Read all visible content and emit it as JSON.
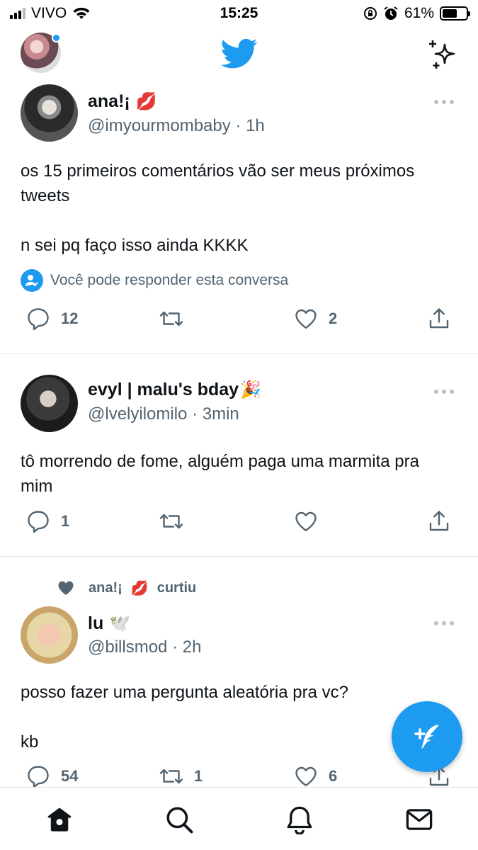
{
  "status_bar": {
    "carrier": "VIVO",
    "time": "15:25",
    "battery": "61%",
    "battery_level": 0.61
  },
  "header": {
    "logo_icon": "twitter-bird-icon",
    "sparkle_icon": "sparkle-icon",
    "accent": "#1d9bf0"
  },
  "tweets": [
    {
      "name": "ana!¡",
      "emoji": "💋",
      "handle": "@imyourmombaby",
      "time": "· 1h",
      "text": "os 15 primeiros comentários vão ser meus próximos tweets\n\nn sei pq faço isso ainda KKKK",
      "reply_note": "Você pode responder esta conversa",
      "replies": "12",
      "retweets": "",
      "likes": "2"
    },
    {
      "name": "evyl | malu's bday",
      "emoji": "🎉",
      "handle": "@lvelyilomilo",
      "time": "· 3min",
      "text": "tô morrendo de fome, alguém paga uma marmita pra mim",
      "replies": "1",
      "retweets": "",
      "likes": ""
    },
    {
      "liked_by": "ana!¡",
      "liked_by_emoji": "💋",
      "liked_suffix": "curtiu",
      "name": "lu",
      "emoji": "🕊️",
      "handle": "@billsmod",
      "time": "· 2h",
      "text": "posso fazer uma pergunta aleatória pra vc?\n\nkb",
      "replies": "54",
      "retweets": "1",
      "likes": "6"
    }
  ],
  "tabs": [
    "home-icon",
    "search-icon",
    "notifications-icon",
    "messages-icon"
  ]
}
